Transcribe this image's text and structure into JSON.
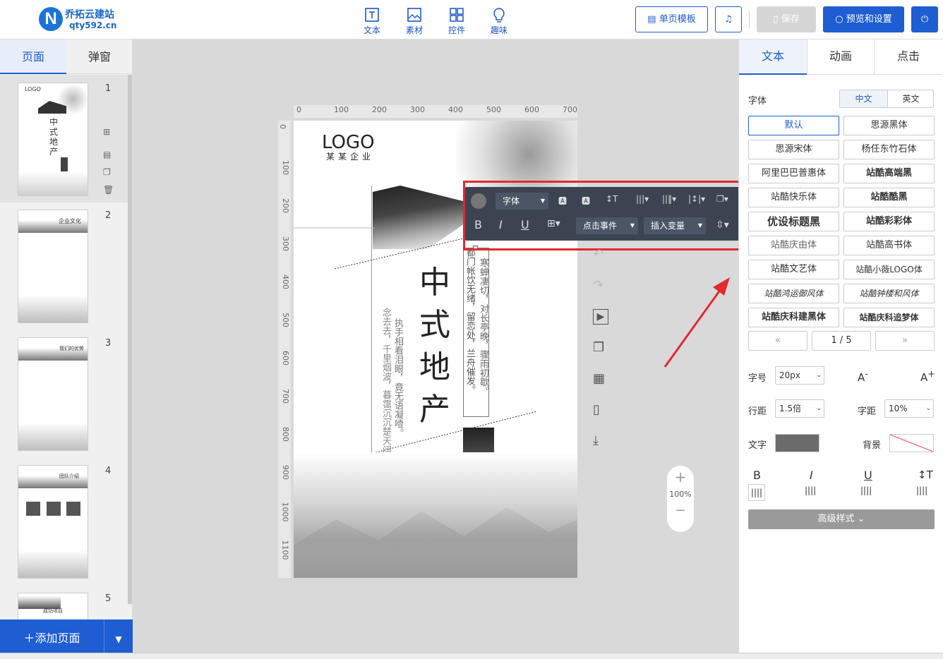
{
  "header": {
    "logo_mark": "N",
    "logo_line1": "乔拓云建站",
    "logo_line2": "qty592.cn",
    "tools": [
      "文本",
      "素材",
      "控件",
      "趣味"
    ],
    "single_template": "单页模板",
    "save": "保存",
    "preview": "预览和设置"
  },
  "left_panel": {
    "tabs": [
      "页面",
      "弹窗"
    ],
    "pages": [
      "1",
      "2",
      "3",
      "4",
      "5"
    ],
    "thumb_texts": {
      "p1_logo": "LOGO",
      "p1_title": "中式地产",
      "p2_title": "企业文化",
      "p3_title": "我们的优势",
      "p4_title": "团队介绍",
      "p5_title": "成功项目"
    },
    "add_page": "添加页面"
  },
  "ruler": {
    "h": [
      "0",
      "100",
      "200",
      "300",
      "400",
      "500",
      "600",
      "700"
    ],
    "v": [
      "0",
      "100",
      "200",
      "300",
      "400",
      "500",
      "600",
      "700",
      "800",
      "900",
      "1000",
      "1100"
    ]
  },
  "page": {
    "logo": "LOGO",
    "company": "某某企业",
    "title": [
      "中",
      "式",
      "地",
      "产"
    ],
    "poem1": "寒蝉凄切，对长亭晚，骤雨初歇。",
    "poem2": "都门帐饮无绪，留恋处，兰舟催发。",
    "poem3": "执手相看泪眼，竟无语凝噎。",
    "poem4": "念去去，千里烟波，暮霭沉沉楚天阔。"
  },
  "float_toolbar": {
    "font": "字体",
    "click_event": "点击事件",
    "insert_var": "插入变量",
    "bold": "B",
    "italic": "I",
    "underline": "U"
  },
  "zoom": {
    "plus": "+",
    "value": "100%",
    "minus": "−"
  },
  "right_panel": {
    "tabs": [
      "文本",
      "动画",
      "点击"
    ],
    "font_label": "字体",
    "lang": [
      "中文",
      "英文"
    ],
    "fonts": [
      [
        "默认",
        "思源黑体"
      ],
      [
        "思源宋体",
        "杨任东竹石体"
      ],
      [
        "阿里巴巴普惠体",
        "站酷高端黑"
      ],
      [
        "站酷快乐体",
        "站酷酷黑"
      ],
      [
        "优设标题黑",
        "站酷彩彩体"
      ],
      [
        "站酷庆由体",
        "站酷高书体"
      ],
      [
        "站酷文艺体",
        "站酷小薇LOGO体"
      ],
      [
        "站酷鸿运御风体",
        "站酷钟楼和风体"
      ],
      [
        "站酷庆科建黑体",
        "站酷庆科追梦体"
      ]
    ],
    "pager": {
      "prev": "«",
      "page": "1 / 5",
      "next": "»"
    },
    "size_label": "字号",
    "size_value": "20px",
    "line_label": "行距",
    "line_value": "1.5倍",
    "spacing_label": "字距",
    "spacing_value": "10%",
    "text_label": "文字",
    "bg_label": "背景",
    "text_color": "#6b6b6b",
    "style_buttons": [
      "B",
      "I",
      "U"
    ],
    "advanced": "高级样式"
  },
  "colors": {
    "accent": "#1e5dd2",
    "highlight": "#e3292d"
  }
}
